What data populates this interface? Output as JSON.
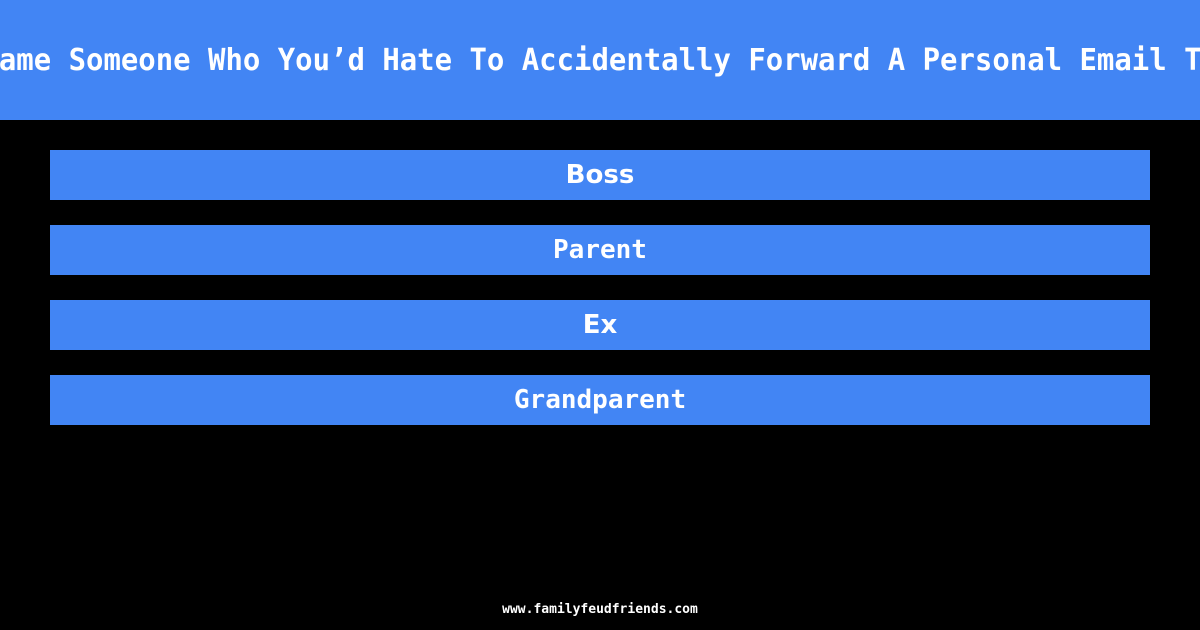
{
  "theme": {
    "background_color": "#000000",
    "accent_color": "#4285F4",
    "text_color": "#FFFFFF"
  },
  "header": {
    "question": "Name Someone Who You’d Hate To Accidentally Forward A Personal Email To"
  },
  "answers": [
    {
      "rank": 1,
      "label": "Boss"
    },
    {
      "rank": 2,
      "label": "Parent"
    },
    {
      "rank": 3,
      "label": "Ex"
    },
    {
      "rank": 4,
      "label": "Grandparent"
    }
  ],
  "footer": {
    "url": "www.familyfeudfriends.com"
  }
}
